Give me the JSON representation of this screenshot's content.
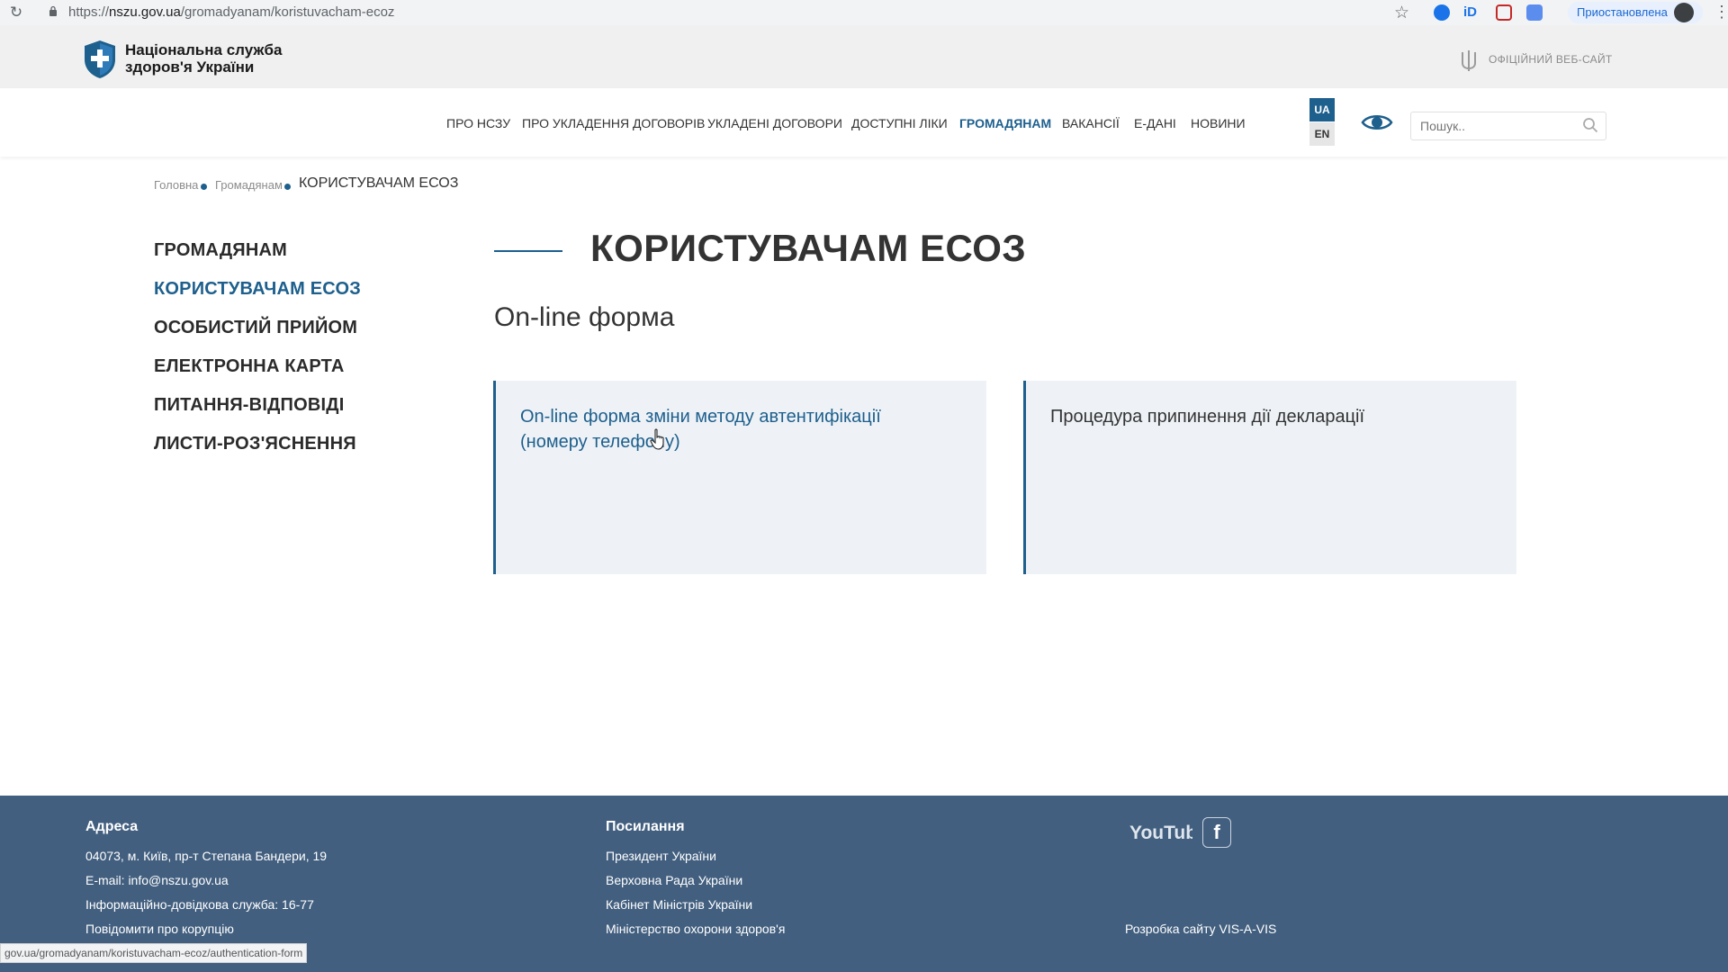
{
  "browser": {
    "url_scheme": "https://",
    "url_host": "nszu.gov.ua",
    "url_path": "/gromadyanam/koristuvacham-ecoz",
    "profile_label": "Приостановлена",
    "status_url": "gov.ua/gromadyanam/koristuvacham-ecoz/authentication-form"
  },
  "header": {
    "logo_line1": "Національна служба",
    "logo_line2": "здоров'я України",
    "official_label": "ОФІЦІЙНИЙ ВЕБ-САЙТ"
  },
  "nav": {
    "items": [
      {
        "label": "ПРО НСЗУ"
      },
      {
        "label": "ПРО УКЛАДЕННЯ ДОГОВОРІВ"
      },
      {
        "label": "УКЛАДЕНІ ДОГОВОРИ"
      },
      {
        "label": "ДОСТУПНІ ЛІКИ"
      },
      {
        "label": "ГРОМАДЯНАМ",
        "active": true
      },
      {
        "label": "ВАКАНСІЇ"
      },
      {
        "label": "Е-ДАНІ"
      },
      {
        "label": "НОВИНИ"
      }
    ],
    "lang_ua": "UA",
    "lang_en": "EN",
    "search_placeholder": "Пошук.."
  },
  "breadcrumb": {
    "home": "Головна",
    "parent": "Громадянам",
    "current": "КОРИСТУВАЧАМ ЕСОЗ"
  },
  "sidebar": {
    "items": [
      {
        "label": "ГРОМАДЯНАМ"
      },
      {
        "label": "КОРИСТУВАЧАМ ЕСОЗ",
        "active": true
      },
      {
        "label": "ОСОБИСТИЙ ПРИЙОМ"
      },
      {
        "label": "ЕЛЕКТРОННА КАРТА"
      },
      {
        "label": "ПИТАННЯ-ВІДПОВІДІ"
      },
      {
        "label": "ЛИСТИ-РОЗ'ЯСНЕННЯ"
      }
    ]
  },
  "main": {
    "title": "КОРИСТУВАЧАМ ЕСОЗ",
    "section_title": "On-line форма",
    "cards": [
      {
        "label": "On-line форма зміни методу автентифікації (номеру телефону)"
      },
      {
        "label": "Процедура припинення дії декларації"
      }
    ]
  },
  "footer": {
    "address_heading": "Адреса",
    "address": "04073, м. Київ, пр-т Степана Бандери, 19",
    "email_line": "E-mail: info@nszu.gov.ua",
    "helpline": "Інформаційно-довідкова служба: 16-77",
    "report_corruption": "Повідомити про корупцію",
    "links_heading": "Посилання",
    "links": [
      {
        "label": "Президент України"
      },
      {
        "label": "Верховна Рада України"
      },
      {
        "label": "Кабінет Міністрів України"
      },
      {
        "label": "Міністерство охорони здоров'я"
      }
    ],
    "youtube_label": "YouTube",
    "facebook_label": "f",
    "dev_credit": "Розробка сайту VIS-A-VIS"
  },
  "colors": {
    "accent": "#1d5f8d",
    "footer_bg": "#425f7f",
    "card_bg": "#eef2f6"
  }
}
